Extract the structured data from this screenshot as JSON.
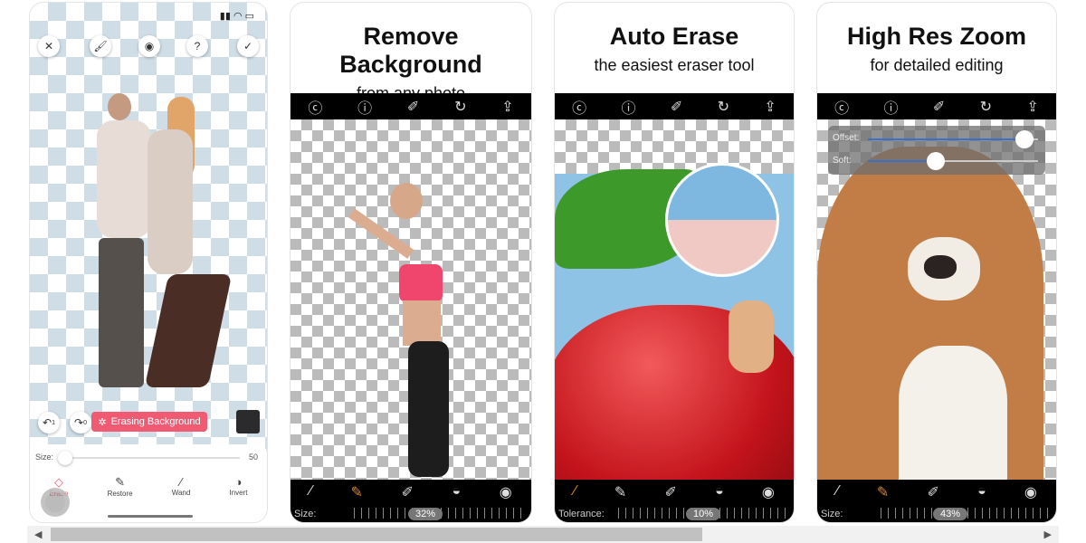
{
  "panel1": {
    "toolbar_icons": [
      "close-icon",
      "brush-icon",
      "eye-icon",
      "help-icon",
      "check-icon"
    ],
    "undo_count": "1",
    "redo_count": "0",
    "status_button": "Erasing Background",
    "size_label": "Size:",
    "size_value": "50",
    "size_fraction": 0.0,
    "tools": [
      {
        "label": "Erase",
        "icon": "eraser-icon"
      },
      {
        "label": "Restore",
        "icon": "pen-icon"
      },
      {
        "label": "Wand",
        "icon": "wand-icon"
      },
      {
        "label": "Invert",
        "icon": "invert-icon"
      }
    ],
    "accent": "#f05a73"
  },
  "panel2": {
    "title": "Remove Background",
    "subtitle": "from any photo",
    "size_label": "Size:",
    "size_value": "32%"
  },
  "panel3": {
    "title": "Auto Erase",
    "subtitle": "the easiest eraser tool",
    "tolerance_label": "Tolerance:",
    "tolerance_value": "10%"
  },
  "panel4": {
    "title": "High Res Zoom",
    "subtitle": "for detailed editing",
    "offset_label": "Offset:",
    "soft_label": "Soft:",
    "offset_value": 0.92,
    "soft_value": 0.4,
    "size_label": "Size:",
    "size_value": "43%"
  },
  "common": {
    "top_icons": [
      "back-icon",
      "help-icon",
      "brush-icon",
      "undo-icon",
      "share-icon"
    ],
    "bottom_icons": [
      "wand-icon",
      "pen-icon",
      "eraser-icon",
      "invert-icon",
      "eye-icon"
    ],
    "tool_accent": "#d98a2b"
  }
}
